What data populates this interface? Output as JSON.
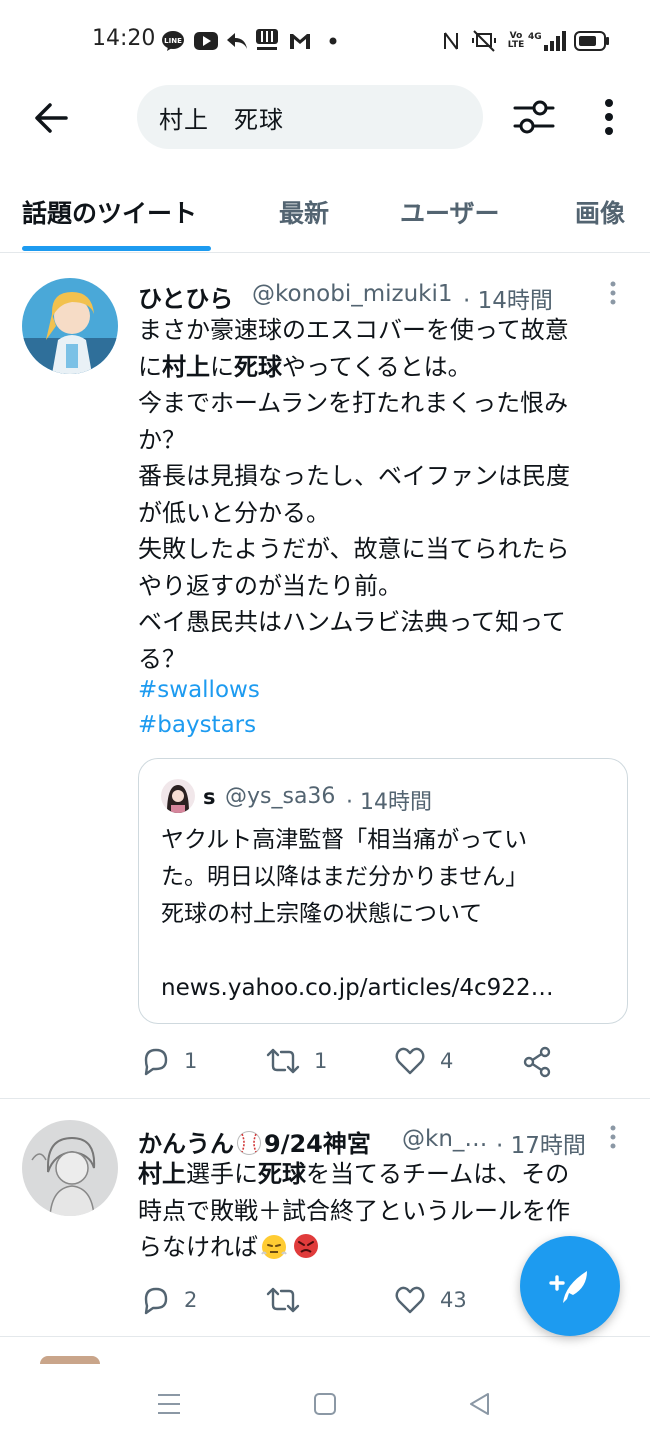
{
  "status_bar": {
    "time": "14:20",
    "icons": [
      "line-icon",
      "youtube-icon",
      "reply-arrow-icon",
      "hokuma-icon",
      "gmail-icon",
      "dot-icon",
      "nfc-icon",
      "vibrate-mute-icon",
      "volte-icon",
      "4g-signal-icon",
      "battery-icon"
    ],
    "line_label": "LINE",
    "volte_label": "Vo\nLTE",
    "net_label": "4G"
  },
  "header": {
    "search_query": "村上　死球"
  },
  "tabs": [
    {
      "label": "話題のツイート",
      "active": true
    },
    {
      "label": "最新",
      "active": false
    },
    {
      "label": "ユーザー",
      "active": false
    },
    {
      "label": "画像",
      "active": false
    }
  ],
  "tweets": [
    {
      "display_name": "ひとひら",
      "handle": "@konobi_mizuki1",
      "time": "· 14時間",
      "body_lines": [
        [
          "まさか豪速球のエスコバーを使って故意"
        ],
        [
          "に",
          "村上",
          "に",
          "死球",
          "やってくるとは。"
        ],
        [
          "今までホームランを打たれまくった恨み"
        ],
        [
          "か？"
        ],
        [
          "番長は見損なったし、ベイファンは民度"
        ],
        [
          "が低いと分かる。"
        ],
        [
          "失敗したようだが、故意に当てられたら"
        ],
        [
          "やり返すのが当たり前。"
        ],
        [
          "ベイ愚民共はハンムラビ法典って知って"
        ],
        [
          "る？"
        ]
      ],
      "hashtags": [
        "#swallows",
        "#baystars"
      ],
      "quote": {
        "display_name": "s",
        "handle": "@ys_sa36",
        "time": "· 14時間",
        "lines": [
          "ヤクルト高津監督「相当痛がってい",
          "た。明日以降はまだ分かりません」",
          "死球の村上宗隆の状態について",
          "",
          "news.yahoo.co.jp/articles/4c922…"
        ]
      },
      "replies": "1",
      "retweets": "1",
      "likes": "4"
    },
    {
      "display_name": "かんうん",
      "name_suffix": "9/24神宮",
      "handle": "@kn_…",
      "time": "· 17時間",
      "body_lines": [
        [
          "村上",
          "選手に",
          "死球",
          "を当てるチームは、その"
        ],
        [
          "時点で敗戦＋試合終了というルールを作"
        ],
        [
          "らなければ"
        ]
      ],
      "replies": "2",
      "retweets": "",
      "likes": "43"
    }
  ],
  "colors": {
    "accent": "#1d9bf0",
    "text": "#0f1419",
    "secondary": "#536471",
    "search_bg": "#eff3f4"
  }
}
